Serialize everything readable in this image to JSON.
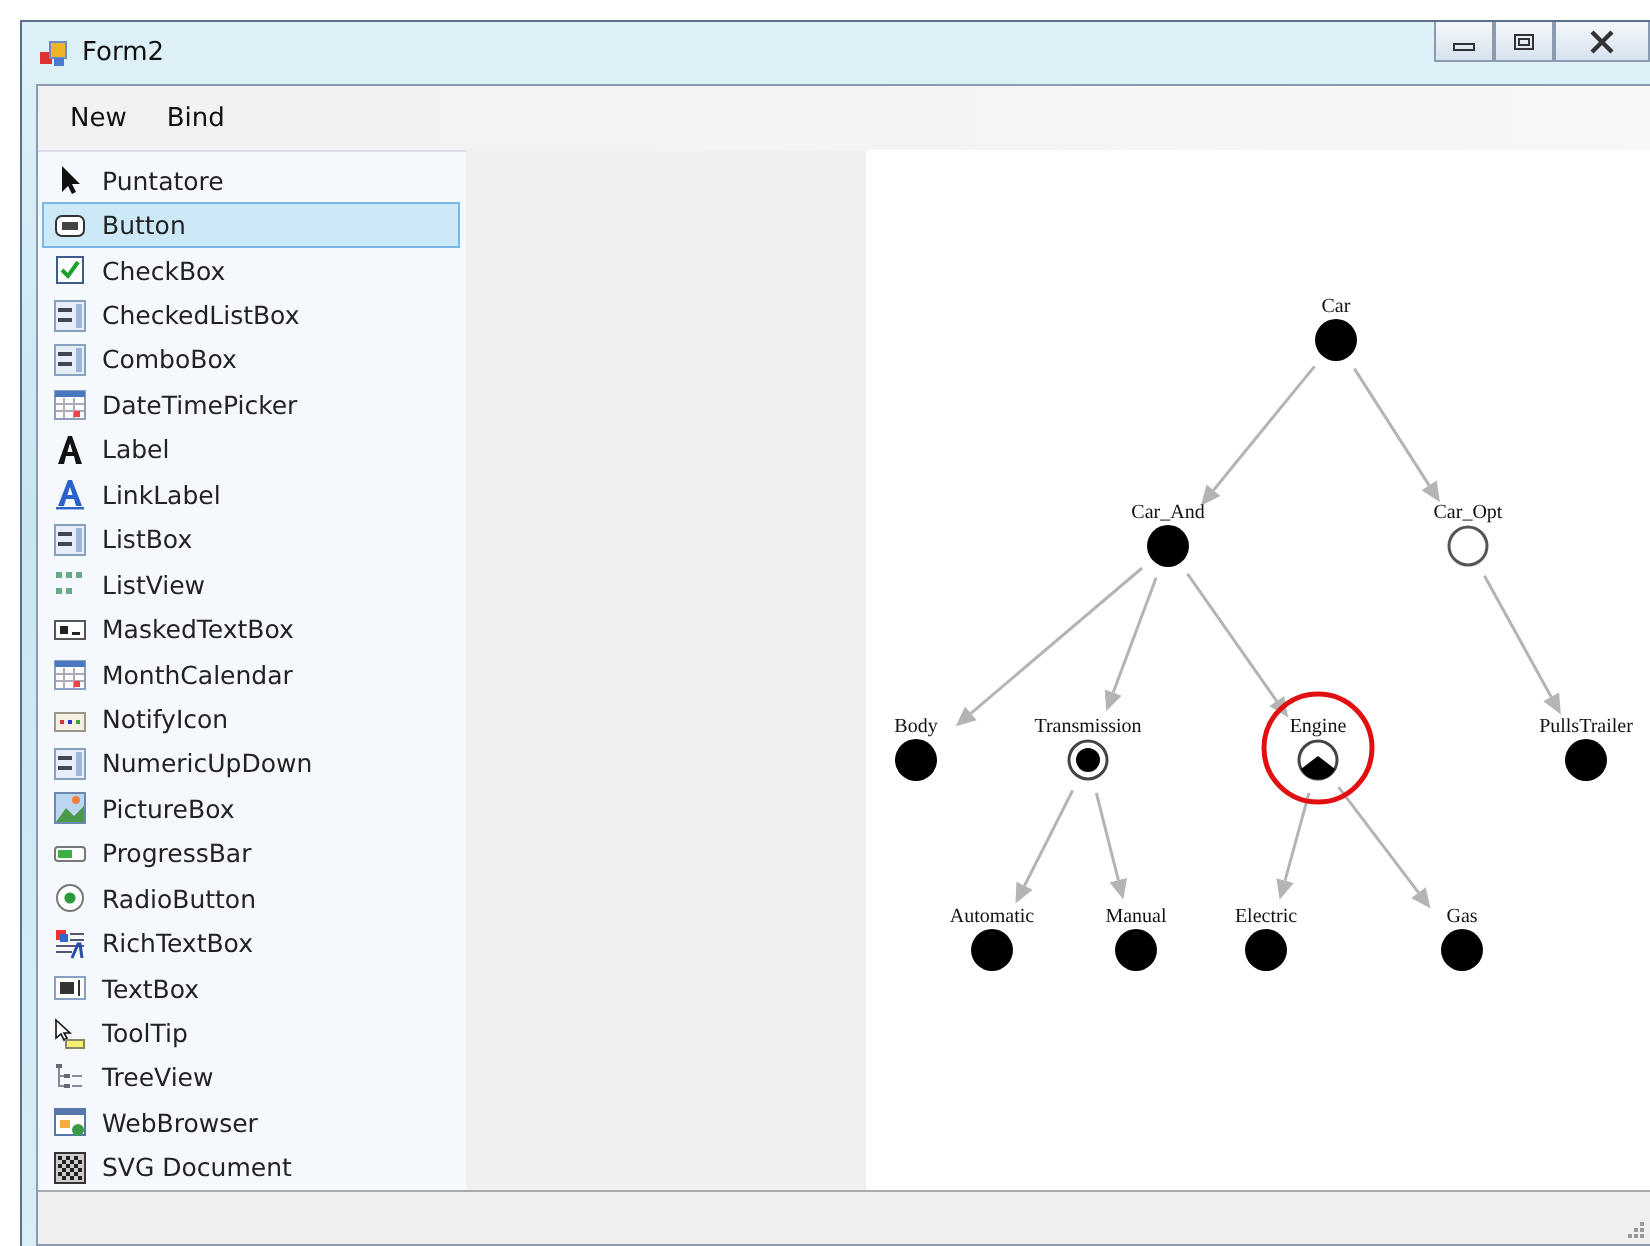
{
  "window": {
    "title": "Form2"
  },
  "menu": [
    "New",
    "Bind"
  ],
  "toolbox": {
    "items": [
      {
        "label": "Puntatore",
        "selected": false
      },
      {
        "label": "Button",
        "selected": true
      },
      {
        "label": "CheckBox",
        "selected": false
      },
      {
        "label": "CheckedListBox",
        "selected": false
      },
      {
        "label": "ComboBox",
        "selected": false
      },
      {
        "label": "DateTimePicker",
        "selected": false
      },
      {
        "label": "Label",
        "selected": false
      },
      {
        "label": "LinkLabel",
        "selected": false
      },
      {
        "label": "ListBox",
        "selected": false
      },
      {
        "label": "ListView",
        "selected": false
      },
      {
        "label": "MaskedTextBox",
        "selected": false
      },
      {
        "label": "MonthCalendar",
        "selected": false
      },
      {
        "label": "NotifyIcon",
        "selected": false
      },
      {
        "label": "NumericUpDown",
        "selected": false
      },
      {
        "label": "PictureBox",
        "selected": false
      },
      {
        "label": "ProgressBar",
        "selected": false
      },
      {
        "label": "RadioButton",
        "selected": false
      },
      {
        "label": "RichTextBox",
        "selected": false
      },
      {
        "label": "TextBox",
        "selected": false
      },
      {
        "label": "ToolTip",
        "selected": false
      },
      {
        "label": "TreeView",
        "selected": false
      },
      {
        "label": "WebBrowser",
        "selected": false
      },
      {
        "label": "SVG Document",
        "selected": false
      }
    ]
  },
  "diagram": {
    "root": {
      "label": "Car",
      "kind": "mandatory",
      "highlighted": false,
      "children": [
        {
          "label": "Car_And",
          "kind": "mandatory",
          "highlighted": false,
          "children": [
            {
              "label": "Body",
              "kind": "mandatory",
              "highlighted": false
            },
            {
              "label": "Transmission",
              "kind": "alternative",
              "highlighted": false,
              "children": [
                {
                  "label": "Automatic",
                  "kind": "mandatory",
                  "highlighted": false
                },
                {
                  "label": "Manual",
                  "kind": "mandatory",
                  "highlighted": false
                }
              ]
            },
            {
              "label": "Engine",
              "kind": "or",
              "highlighted": true,
              "children": [
                {
                  "label": "Electric",
                  "kind": "mandatory",
                  "highlighted": false
                },
                {
                  "label": "Gas",
                  "kind": "mandatory",
                  "highlighted": false
                }
              ]
            }
          ]
        },
        {
          "label": "Car_Opt",
          "kind": "optional",
          "highlighted": false,
          "children": [
            {
              "label": "PullsTrailer",
              "kind": "mandatory",
              "highlighted": false
            }
          ]
        }
      ]
    }
  }
}
